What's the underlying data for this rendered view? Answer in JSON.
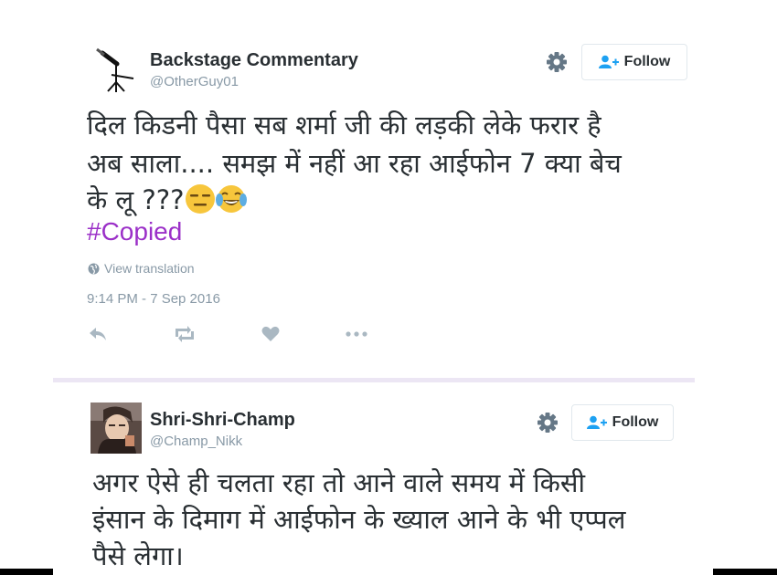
{
  "tweets": [
    {
      "user": {
        "name": "Backstage Commentary",
        "handle": "@OtherGuy01"
      },
      "follow_label": "Follow",
      "text_lines": [
        "दिल किडनी पैसा सब शर्मा जी की लड़की लेके फरार है",
        "अब साला.... समझ में  नहीं आ रहा आईफोन 7 क्या बेच",
        "के लू ???"
      ],
      "emojis": [
        "expressionless-face-emoji",
        "crying-laughing-face-emoji"
      ],
      "hashtag": "#Copied",
      "view_translation": "View translation",
      "timestamp": "9:14 PM - 7 Sep 2016",
      "actions": [
        "reply-icon",
        "retweet-icon",
        "like-icon",
        "more-icon"
      ]
    },
    {
      "user": {
        "name": "Shri-Shri-Champ",
        "handle": "@Champ_Nikk"
      },
      "follow_label": "Follow",
      "text_lines": [
        "अगर ऐसे ही चलता रहा तो आने वाले समय में किसी",
        "इंसान के दिमाग में आईफोन के ख्याल आने के भी एप्पल",
        "पैसे लेगा।"
      ]
    }
  ],
  "colors": {
    "text": "#292f33",
    "secondary": "#8899a6",
    "follow_icon": "#1da1f2",
    "hashtag": "#9b30c8",
    "divider": "#ece6f4"
  }
}
